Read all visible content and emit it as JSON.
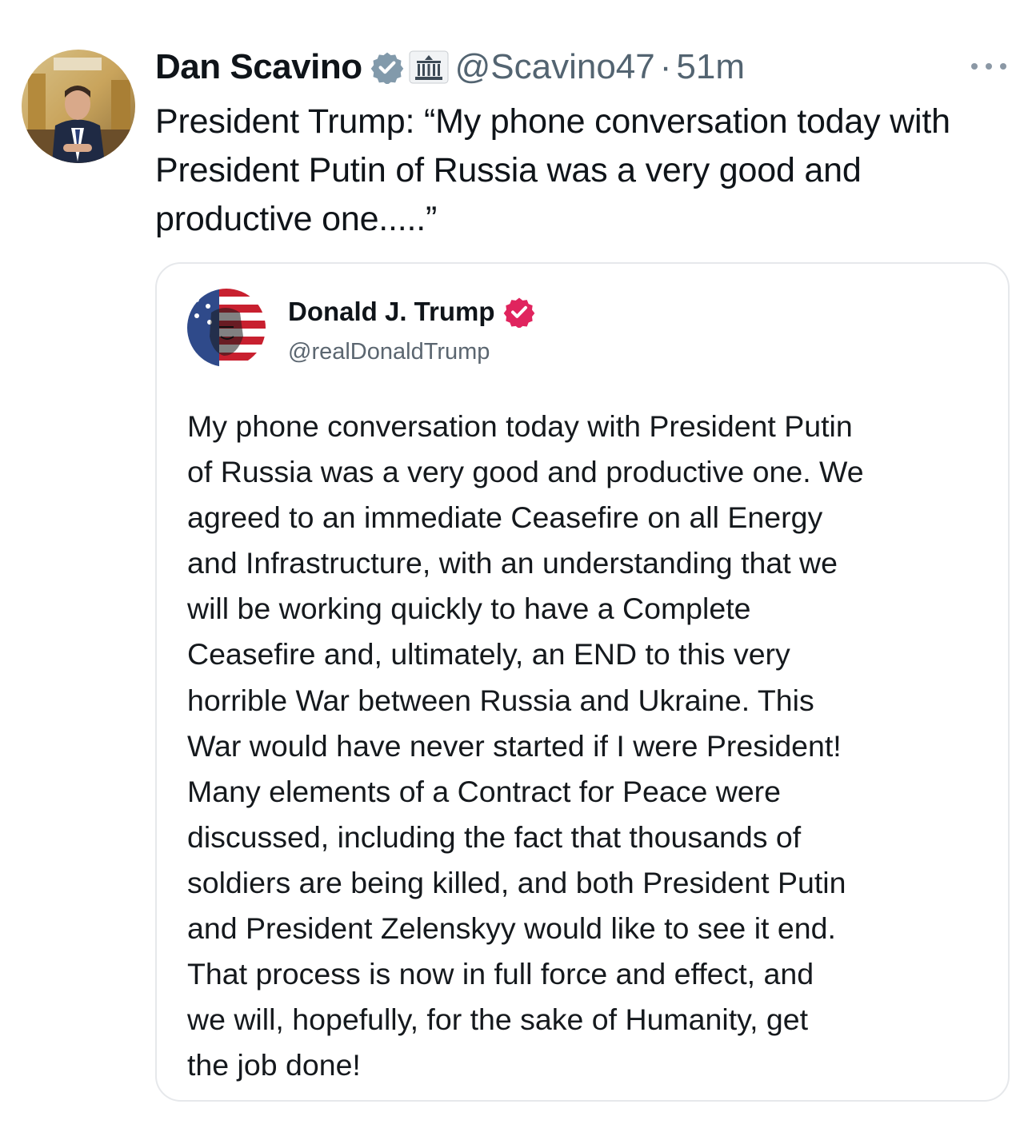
{
  "tweet": {
    "author_name": "Dan Scavino",
    "author_handle": "@Scavino47",
    "separator": "·",
    "timestamp": "51m",
    "more_icon": "more-horizontal-icon",
    "badges": [
      "verified-badge-icon",
      "government-building-icon"
    ],
    "text": "President Trump: “My phone conversation today with President Putin of Russia was a very good and productive one.....”"
  },
  "quoted_post": {
    "author_name": "Donald J. Trump",
    "author_handle": "@realDonaldTrump",
    "badge": "verified-badge-icon",
    "badge_color": "#e0245e",
    "text_lines": [
      "My phone conversation today with President Putin",
      "of Russia was a very good and productive one. We",
      "agreed to an immediate Ceasefire on all Energy",
      "and Infrastructure, with an understanding that we",
      "will be working quickly to have a Complete",
      "Ceasefire and, ultimately, an END to this very",
      "horrible War between Russia and Ukraine. This",
      "War would have never started if I were President!",
      "Many elements of a Contract for Peace were",
      "discussed, including the fact that thousands of",
      "soldiers are being killed, and both President Putin",
      "and President Zelenskyy would like to see it end.",
      "That process is now in full force and effect, and",
      "we will, hopefully, for the sake of Humanity, get",
      "the job done!"
    ]
  },
  "colors": {
    "primary_text": "#0f1419",
    "secondary_text": "#536471",
    "verified_blue": "#1d9bf0",
    "card_border": "#e6e8eb"
  }
}
